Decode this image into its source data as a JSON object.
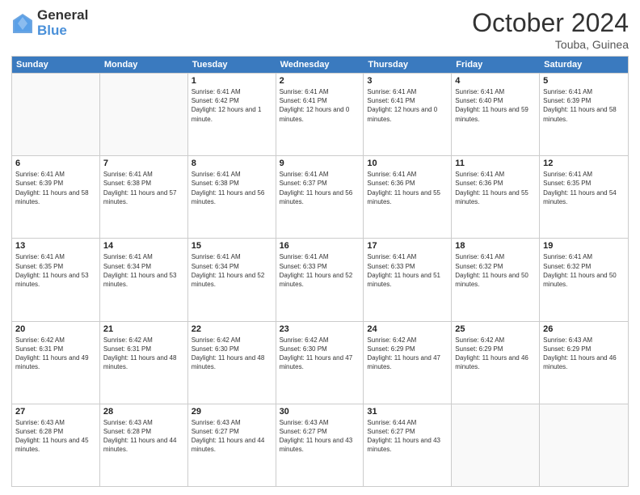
{
  "logo": {
    "general": "General",
    "blue": "Blue"
  },
  "title": "October 2024",
  "location": "Touba, Guinea",
  "days_of_week": [
    "Sunday",
    "Monday",
    "Tuesday",
    "Wednesday",
    "Thursday",
    "Friday",
    "Saturday"
  ],
  "weeks": [
    [
      {
        "day": "",
        "sunrise": "",
        "sunset": "",
        "daylight": ""
      },
      {
        "day": "",
        "sunrise": "",
        "sunset": "",
        "daylight": ""
      },
      {
        "day": "1",
        "sunrise": "Sunrise: 6:41 AM",
        "sunset": "Sunset: 6:42 PM",
        "daylight": "Daylight: 12 hours and 1 minute."
      },
      {
        "day": "2",
        "sunrise": "Sunrise: 6:41 AM",
        "sunset": "Sunset: 6:41 PM",
        "daylight": "Daylight: 12 hours and 0 minutes."
      },
      {
        "day": "3",
        "sunrise": "Sunrise: 6:41 AM",
        "sunset": "Sunset: 6:41 PM",
        "daylight": "Daylight: 12 hours and 0 minutes."
      },
      {
        "day": "4",
        "sunrise": "Sunrise: 6:41 AM",
        "sunset": "Sunset: 6:40 PM",
        "daylight": "Daylight: 11 hours and 59 minutes."
      },
      {
        "day": "5",
        "sunrise": "Sunrise: 6:41 AM",
        "sunset": "Sunset: 6:39 PM",
        "daylight": "Daylight: 11 hours and 58 minutes."
      }
    ],
    [
      {
        "day": "6",
        "sunrise": "Sunrise: 6:41 AM",
        "sunset": "Sunset: 6:39 PM",
        "daylight": "Daylight: 11 hours and 58 minutes."
      },
      {
        "day": "7",
        "sunrise": "Sunrise: 6:41 AM",
        "sunset": "Sunset: 6:38 PM",
        "daylight": "Daylight: 11 hours and 57 minutes."
      },
      {
        "day": "8",
        "sunrise": "Sunrise: 6:41 AM",
        "sunset": "Sunset: 6:38 PM",
        "daylight": "Daylight: 11 hours and 56 minutes."
      },
      {
        "day": "9",
        "sunrise": "Sunrise: 6:41 AM",
        "sunset": "Sunset: 6:37 PM",
        "daylight": "Daylight: 11 hours and 56 minutes."
      },
      {
        "day": "10",
        "sunrise": "Sunrise: 6:41 AM",
        "sunset": "Sunset: 6:36 PM",
        "daylight": "Daylight: 11 hours and 55 minutes."
      },
      {
        "day": "11",
        "sunrise": "Sunrise: 6:41 AM",
        "sunset": "Sunset: 6:36 PM",
        "daylight": "Daylight: 11 hours and 55 minutes."
      },
      {
        "day": "12",
        "sunrise": "Sunrise: 6:41 AM",
        "sunset": "Sunset: 6:35 PM",
        "daylight": "Daylight: 11 hours and 54 minutes."
      }
    ],
    [
      {
        "day": "13",
        "sunrise": "Sunrise: 6:41 AM",
        "sunset": "Sunset: 6:35 PM",
        "daylight": "Daylight: 11 hours and 53 minutes."
      },
      {
        "day": "14",
        "sunrise": "Sunrise: 6:41 AM",
        "sunset": "Sunset: 6:34 PM",
        "daylight": "Daylight: 11 hours and 53 minutes."
      },
      {
        "day": "15",
        "sunrise": "Sunrise: 6:41 AM",
        "sunset": "Sunset: 6:34 PM",
        "daylight": "Daylight: 11 hours and 52 minutes."
      },
      {
        "day": "16",
        "sunrise": "Sunrise: 6:41 AM",
        "sunset": "Sunset: 6:33 PM",
        "daylight": "Daylight: 11 hours and 52 minutes."
      },
      {
        "day": "17",
        "sunrise": "Sunrise: 6:41 AM",
        "sunset": "Sunset: 6:33 PM",
        "daylight": "Daylight: 11 hours and 51 minutes."
      },
      {
        "day": "18",
        "sunrise": "Sunrise: 6:41 AM",
        "sunset": "Sunset: 6:32 PM",
        "daylight": "Daylight: 11 hours and 50 minutes."
      },
      {
        "day": "19",
        "sunrise": "Sunrise: 6:41 AM",
        "sunset": "Sunset: 6:32 PM",
        "daylight": "Daylight: 11 hours and 50 minutes."
      }
    ],
    [
      {
        "day": "20",
        "sunrise": "Sunrise: 6:42 AM",
        "sunset": "Sunset: 6:31 PM",
        "daylight": "Daylight: 11 hours and 49 minutes."
      },
      {
        "day": "21",
        "sunrise": "Sunrise: 6:42 AM",
        "sunset": "Sunset: 6:31 PM",
        "daylight": "Daylight: 11 hours and 48 minutes."
      },
      {
        "day": "22",
        "sunrise": "Sunrise: 6:42 AM",
        "sunset": "Sunset: 6:30 PM",
        "daylight": "Daylight: 11 hours and 48 minutes."
      },
      {
        "day": "23",
        "sunrise": "Sunrise: 6:42 AM",
        "sunset": "Sunset: 6:30 PM",
        "daylight": "Daylight: 11 hours and 47 minutes."
      },
      {
        "day": "24",
        "sunrise": "Sunrise: 6:42 AM",
        "sunset": "Sunset: 6:29 PM",
        "daylight": "Daylight: 11 hours and 47 minutes."
      },
      {
        "day": "25",
        "sunrise": "Sunrise: 6:42 AM",
        "sunset": "Sunset: 6:29 PM",
        "daylight": "Daylight: 11 hours and 46 minutes."
      },
      {
        "day": "26",
        "sunrise": "Sunrise: 6:43 AM",
        "sunset": "Sunset: 6:29 PM",
        "daylight": "Daylight: 11 hours and 46 minutes."
      }
    ],
    [
      {
        "day": "27",
        "sunrise": "Sunrise: 6:43 AM",
        "sunset": "Sunset: 6:28 PM",
        "daylight": "Daylight: 11 hours and 45 minutes."
      },
      {
        "day": "28",
        "sunrise": "Sunrise: 6:43 AM",
        "sunset": "Sunset: 6:28 PM",
        "daylight": "Daylight: 11 hours and 44 minutes."
      },
      {
        "day": "29",
        "sunrise": "Sunrise: 6:43 AM",
        "sunset": "Sunset: 6:27 PM",
        "daylight": "Daylight: 11 hours and 44 minutes."
      },
      {
        "day": "30",
        "sunrise": "Sunrise: 6:43 AM",
        "sunset": "Sunset: 6:27 PM",
        "daylight": "Daylight: 11 hours and 43 minutes."
      },
      {
        "day": "31",
        "sunrise": "Sunrise: 6:44 AM",
        "sunset": "Sunset: 6:27 PM",
        "daylight": "Daylight: 11 hours and 43 minutes."
      },
      {
        "day": "",
        "sunrise": "",
        "sunset": "",
        "daylight": ""
      },
      {
        "day": "",
        "sunrise": "",
        "sunset": "",
        "daylight": ""
      }
    ]
  ]
}
